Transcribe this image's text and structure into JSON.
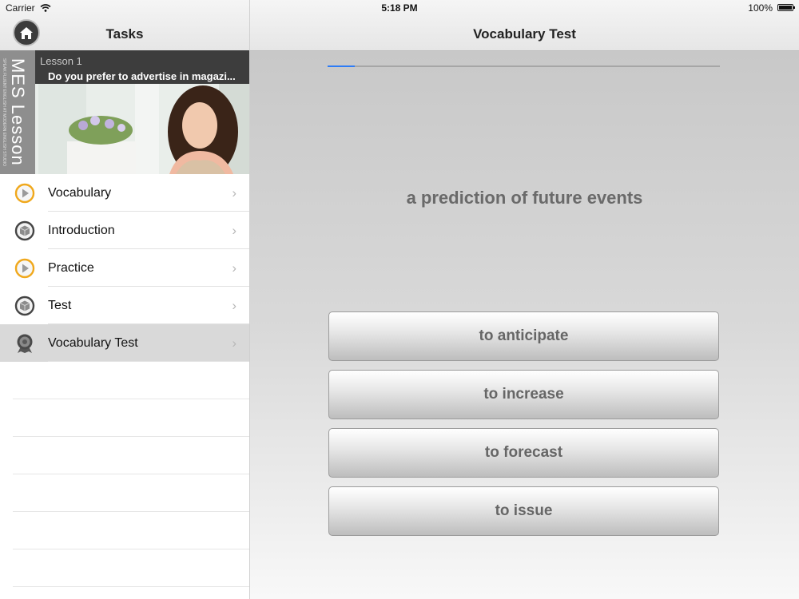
{
  "status": {
    "carrier": "Carrier",
    "time": "5:18 PM",
    "battery": "100%"
  },
  "sidebar": {
    "title": "Tasks",
    "lesson": {
      "label": "Lesson 1",
      "title": "Do you prefer to advertise in magazi...",
      "brand": "MES Lesson",
      "brand_tagline": "SPEAK FLUENT ENGLISH AT MODERN ENGLISH STUDIO"
    },
    "items": [
      {
        "label": "Vocabulary",
        "icon": "play-icon"
      },
      {
        "label": "Introduction",
        "icon": "cube-icon"
      },
      {
        "label": "Practice",
        "icon": "play-icon"
      },
      {
        "label": "Test",
        "icon": "cube-icon"
      },
      {
        "label": "Vocabulary Test",
        "icon": "award-icon",
        "selected": true
      }
    ]
  },
  "main": {
    "title": "Vocabulary Test",
    "progress": 0.07,
    "question": "a prediction of future events",
    "answers": [
      "to anticipate",
      "to increase",
      "to forecast",
      "to issue"
    ]
  },
  "colors": {
    "accent": "#2e7cf6",
    "play_icon": "#f0a81c"
  }
}
